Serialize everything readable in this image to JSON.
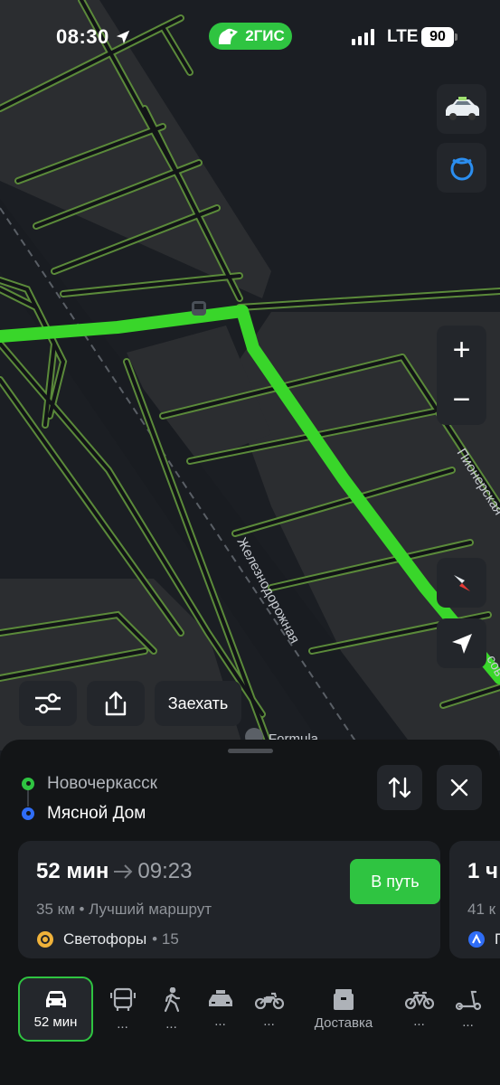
{
  "status_bar": {
    "time": "08:30",
    "brand": "2ГИС",
    "network": "LTE",
    "battery": "90"
  },
  "map": {
    "street_labels": [
      "Железнодорожная",
      "Пионерская",
      "Formula",
      "сов"
    ]
  },
  "map_controls": {
    "zoom_in": "+",
    "zoom_out": "−",
    "enter_label": "Заехать"
  },
  "route": {
    "from": "Новочеркасск",
    "to": "Мясной Дом",
    "primary": {
      "duration": "52 мин",
      "arrival": "09:23",
      "distance": "35 км",
      "separator": "•",
      "route_type": "Лучший маршрут",
      "traffic_lights_label": "Светофоры",
      "traffic_lights_count": "15",
      "go_label": "В путь"
    },
    "alternative": {
      "duration": "1 ч",
      "distance": "41 к",
      "extra": "П"
    }
  },
  "transport_modes": [
    {
      "name": "car",
      "label": "52 мин",
      "active": true
    },
    {
      "name": "bus",
      "label": "..."
    },
    {
      "name": "walk",
      "label": "..."
    },
    {
      "name": "taxi",
      "label": "..."
    },
    {
      "name": "moto",
      "label": "..."
    },
    {
      "name": "delivery",
      "label": "Доставка"
    },
    {
      "name": "bike",
      "label": "..."
    },
    {
      "name": "scooter",
      "label": "..."
    }
  ],
  "colors": {
    "accent": "#2fc441",
    "map_bg": "#1b1e23",
    "route": "#39d62a",
    "sheet_bg": "#131517",
    "card_bg": "#212429",
    "from_dot": "#2fc441",
    "to_dot": "#2f6df6"
  }
}
